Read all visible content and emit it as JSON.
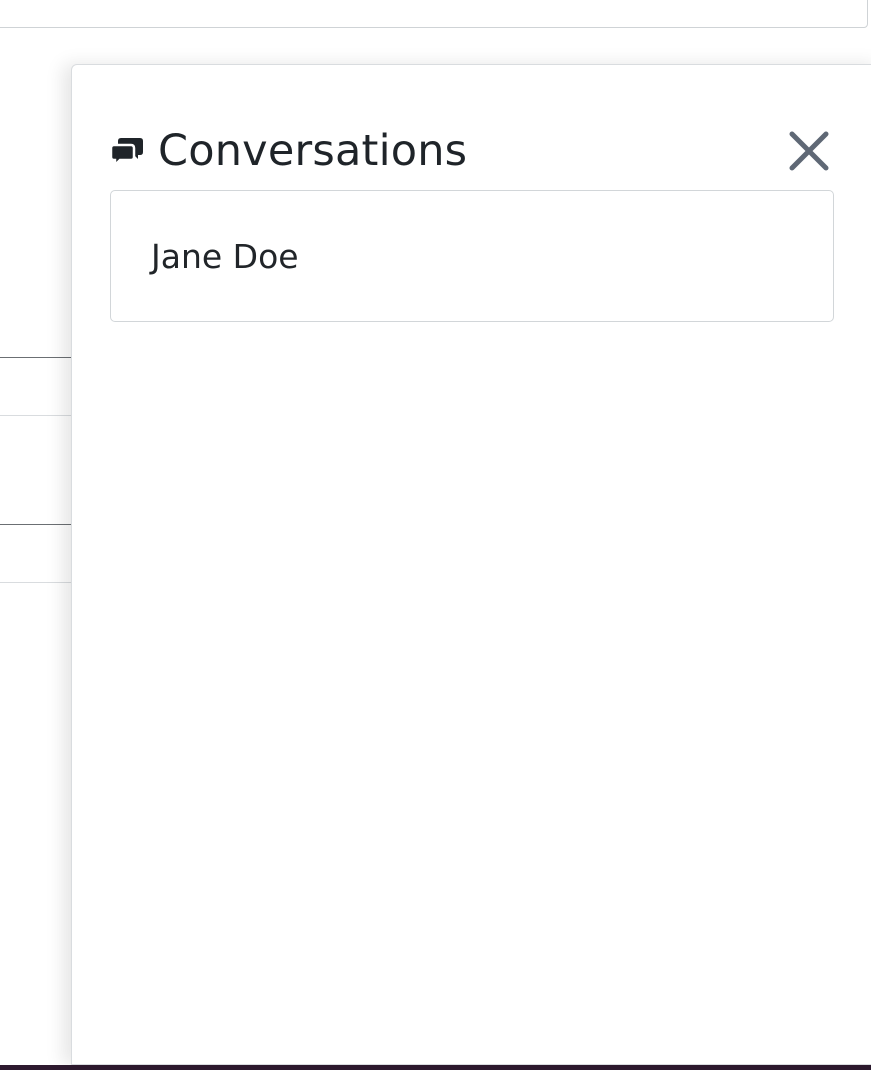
{
  "panel": {
    "title": "Conversations",
    "title_icon": "chat-bubbles-icon",
    "close_icon": "close-icon"
  },
  "conversations": [
    {
      "name": "Jane Doe"
    }
  ],
  "colors": {
    "text": "#1f2429",
    "close_icon": "#5f6875",
    "border": "#d2d6d9",
    "footer_bar": "#2e1a2f"
  }
}
